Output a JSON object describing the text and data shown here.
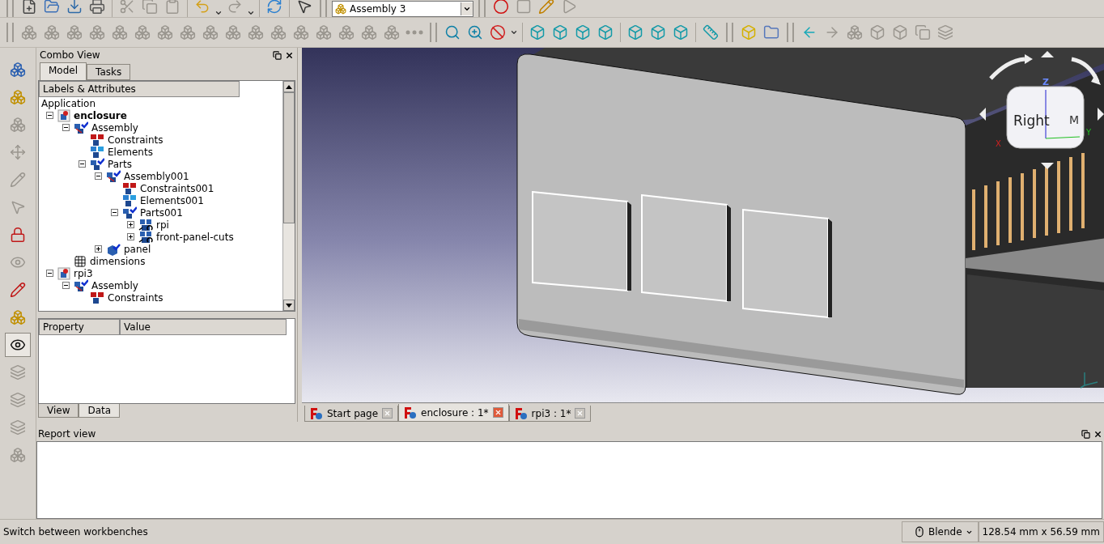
{
  "toolbar_file": [
    {
      "enabled": true
    },
    {
      "enabled": true
    },
    {
      "enabled": true
    },
    {
      "enabled": true
    },
    {
      "enabled": false
    },
    {
      "enabled": false
    },
    {
      "enabled": false
    },
    {
      "enabled": true
    },
    {
      "enabled": false
    },
    {
      "enabled": true
    },
    {
      "enabled": true
    }
  ],
  "workbench": {
    "value": "Assembly 3"
  },
  "toolbar_macro": [
    {
      "enabled": true
    },
    {
      "enabled": false
    },
    {
      "enabled": true
    },
    {
      "enabled": false
    }
  ],
  "toolbar_assembly": [
    {
      "enabled": false
    },
    {
      "enabled": false
    },
    {
      "enabled": false
    },
    {
      "enabled": false
    },
    {
      "enabled": false
    },
    {
      "enabled": false
    },
    {
      "enabled": false
    },
    {
      "enabled": false
    },
    {
      "enabled": false
    },
    {
      "enabled": false
    },
    {
      "enabled": false
    },
    {
      "enabled": false
    },
    {
      "enabled": false
    },
    {
      "enabled": false
    },
    {
      "enabled": false
    },
    {
      "enabled": false
    },
    {
      "enabled": false
    }
  ],
  "toolbar_view": [
    {
      "enabled": true
    },
    {
      "enabled": true
    },
    {
      "enabled": true
    },
    {
      "enabled": true
    },
    {
      "enabled": true
    },
    {
      "enabled": true
    },
    {
      "enabled": true
    },
    {
      "enabled": true
    },
    {
      "enabled": true
    },
    {
      "enabled": true
    },
    {
      "enabled": true
    }
  ],
  "toolbar_structure": [
    {
      "enabled": true
    },
    {
      "enabled": true
    }
  ],
  "toolbar_nav": [
    {
      "enabled": true
    },
    {
      "enabled": false
    },
    {
      "enabled": false
    },
    {
      "enabled": false
    },
    {
      "enabled": false
    },
    {
      "enabled": false
    },
    {
      "enabled": false
    }
  ],
  "left_tools": [
    {
      "enabled": true,
      "active": false
    },
    {
      "enabled": true,
      "active": false
    },
    {
      "enabled": false,
      "active": false
    },
    {
      "enabled": false,
      "active": false
    },
    {
      "enabled": false,
      "active": false
    },
    {
      "enabled": false,
      "active": false
    },
    {
      "enabled": true,
      "active": false
    },
    {
      "enabled": false,
      "active": false
    },
    {
      "enabled": true,
      "active": false
    },
    {
      "enabled": true,
      "active": false
    },
    {
      "enabled": true,
      "active": true
    },
    {
      "enabled": false,
      "active": false
    },
    {
      "enabled": false,
      "active": false
    },
    {
      "enabled": false,
      "active": false
    },
    {
      "enabled": false,
      "active": false
    }
  ],
  "combo_view": {
    "title": "Combo View",
    "tabs": [
      {
        "label": "Model",
        "selected": true
      },
      {
        "label": "Tasks",
        "selected": false
      }
    ],
    "tree_header": "Labels & Attributes",
    "tree": {
      "label": "Application",
      "children": [
        {
          "label": "enclosure",
          "kind": "document",
          "active": true,
          "expanded": true,
          "children": [
            {
              "label": "Assembly",
              "kind": "assembly",
              "expanded": true,
              "children": [
                {
                  "label": "Constraints",
                  "kind": "constraints"
                },
                {
                  "label": "Elements",
                  "kind": "elements"
                },
                {
                  "label": "Parts",
                  "kind": "parts",
                  "expanded": true,
                  "children": [
                    {
                      "label": "Assembly001",
                      "kind": "assembly",
                      "expanded": true,
                      "children": [
                        {
                          "label": "Constraints001",
                          "kind": "constraints"
                        },
                        {
                          "label": "Elements001",
                          "kind": "elements"
                        },
                        {
                          "label": "Parts001",
                          "kind": "parts",
                          "expanded": true,
                          "children": [
                            {
                              "label": "rpi",
                              "kind": "link",
                              "expanded": false
                            },
                            {
                              "label": "front-panel-cuts",
                              "kind": "link",
                              "expanded": false
                            }
                          ]
                        }
                      ]
                    },
                    {
                      "label": "panel",
                      "kind": "part",
                      "expanded": false
                    }
                  ]
                }
              ]
            },
            {
              "label": "dimensions",
              "kind": "spreadsheet"
            }
          ]
        },
        {
          "label": "rpi3",
          "kind": "document",
          "active": false,
          "expanded": true,
          "children": [
            {
              "label": "Assembly",
              "kind": "assembly",
              "expanded": true,
              "children": [
                {
                  "label": "Constraints",
                  "kind": "constraints"
                }
              ]
            }
          ]
        }
      ]
    },
    "property_columns": [
      "Property",
      "Value"
    ],
    "bottom_tabs": [
      {
        "label": "View",
        "selected": false
      },
      {
        "label": "Data",
        "selected": true
      }
    ]
  },
  "view": {
    "nav_cube": {
      "face": "Right",
      "side_face": "M",
      "axis_z": "Z",
      "axis_y": "Y",
      "axis_x": "X"
    }
  },
  "document_tabs": [
    {
      "label": "Start page",
      "selected": false
    },
    {
      "label": "enclosure : 1*",
      "selected": true
    },
    {
      "label": "rpi3 : 1*",
      "selected": false
    }
  ],
  "report_view": {
    "title": "Report view"
  },
  "status_bar": {
    "message": "Switch between workbenches",
    "navigation_style": "Blende",
    "dimensions": "128.54 mm x 56.59 mm"
  }
}
